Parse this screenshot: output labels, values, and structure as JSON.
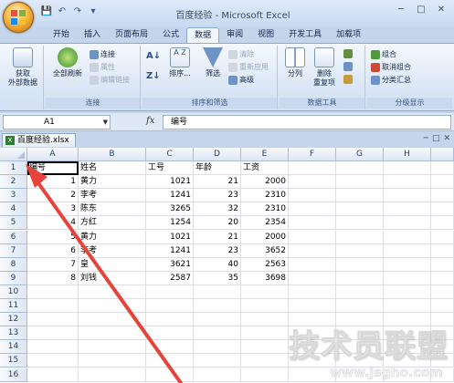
{
  "window": {
    "title": "百度经验 - Microsoft Excel",
    "min_glyph": "─",
    "max_glyph": "□",
    "close_glyph": "✕"
  },
  "qat": {
    "save_glyph": "💾",
    "undo_glyph": "↶",
    "redo_glyph": "↷",
    "more_glyph": "▾"
  },
  "tabs": [
    "开始",
    "插入",
    "页面布局",
    "公式",
    "数据",
    "审阅",
    "视图",
    "开发工具",
    "加载项"
  ],
  "active_tab": "数据",
  "ribbon": {
    "get_external": "获取\n外部数据",
    "refresh_all": "全部刷新",
    "connections": "连接",
    "properties": "属性",
    "edit_links": "编辑链接",
    "connections_group": "连接",
    "sort": "排序...",
    "filter": "筛选",
    "clear": "清除",
    "reapply": "重新应用",
    "advanced": "高级",
    "sort_filter_group": "排序和筛选",
    "text_to_columns": "分列",
    "remove_dupes": "删除\n重复项",
    "data_tools_group": "数据工具",
    "group": "组合",
    "ungroup": "取消组合",
    "subtotal": "分类汇总",
    "outline_group": "分级显示"
  },
  "formula_bar": {
    "name_box": "A1",
    "fx": "fx",
    "content": "编号"
  },
  "workbook": {
    "name": "百度经验.xlsx",
    "xl_badge": "X",
    "min_glyph": "─",
    "max_glyph": "□",
    "close_glyph": "✕"
  },
  "columns": [
    "A",
    "B",
    "C",
    "D",
    "E",
    "F",
    "G",
    "H"
  ],
  "rows": [
    "1",
    "2",
    "3",
    "4",
    "5",
    "6",
    "7",
    "8",
    "9",
    "10",
    "11",
    "12",
    "13",
    "14",
    "15",
    "16"
  ],
  "cells": [
    [
      "编号",
      "姓名",
      "工号",
      "年龄",
      "工资"
    ],
    [
      "1",
      "黄力",
      "1021",
      "21",
      "2000"
    ],
    [
      "2",
      "李考",
      "1241",
      "23",
      "2310"
    ],
    [
      "3",
      "陈东",
      "3265",
      "32",
      "2310"
    ],
    [
      "4",
      "方红",
      "1254",
      "20",
      "2354"
    ],
    [
      "5",
      "黄力",
      "1021",
      "21",
      "2000"
    ],
    [
      "6",
      "李考",
      "1241",
      "23",
      "3652"
    ],
    [
      "7",
      "皇",
      "3621",
      "40",
      "2563"
    ],
    [
      "8",
      "刘钱",
      "2587",
      "35",
      "3698"
    ]
  ],
  "watermark": {
    "brand": "技术员联盟",
    "url": "www.jsgho.com"
  },
  "colors": {
    "accent": "#c5d6ec",
    "arrow": "#e8433a"
  }
}
